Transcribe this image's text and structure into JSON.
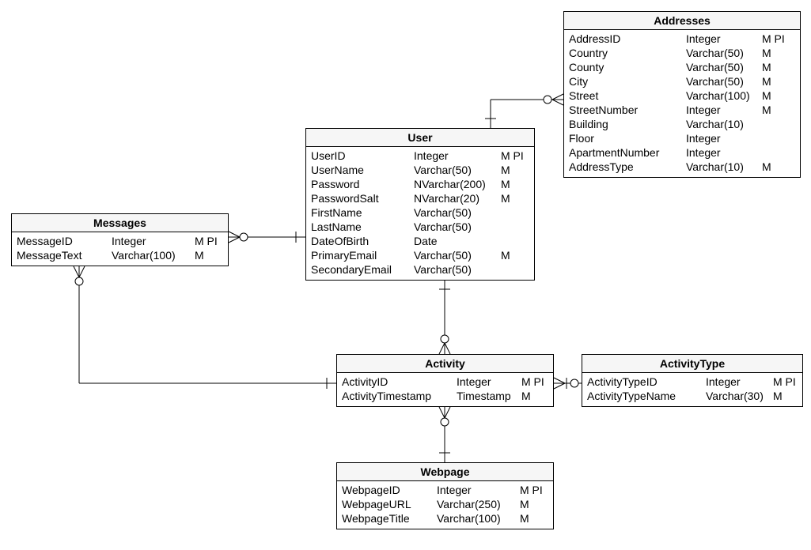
{
  "entities": {
    "addresses": {
      "title": "Addresses",
      "fields": [
        {
          "name": "AddressID",
          "type": "Integer",
          "flags": "M PI"
        },
        {
          "name": "Country",
          "type": "Varchar(50)",
          "flags": "M"
        },
        {
          "name": "County",
          "type": "Varchar(50)",
          "flags": "M"
        },
        {
          "name": "City",
          "type": "Varchar(50)",
          "flags": "M"
        },
        {
          "name": "Street",
          "type": "Varchar(100)",
          "flags": "M"
        },
        {
          "name": "StreetNumber",
          "type": "Integer",
          "flags": "M"
        },
        {
          "name": "Building",
          "type": "Varchar(10)",
          "flags": ""
        },
        {
          "name": "Floor",
          "type": "Integer",
          "flags": ""
        },
        {
          "name": "ApartmentNumber",
          "type": "Integer",
          "flags": ""
        },
        {
          "name": "AddressType",
          "type": "Varchar(10)",
          "flags": "M"
        }
      ]
    },
    "user": {
      "title": "User",
      "fields": [
        {
          "name": "UserID",
          "type": "Integer",
          "flags": "M PI"
        },
        {
          "name": "UserName",
          "type": "Varchar(50)",
          "flags": "M"
        },
        {
          "name": "Password",
          "type": "NVarchar(200)",
          "flags": "M"
        },
        {
          "name": "PasswordSalt",
          "type": "NVarchar(20)",
          "flags": "M"
        },
        {
          "name": "FirstName",
          "type": "Varchar(50)",
          "flags": ""
        },
        {
          "name": "LastName",
          "type": "Varchar(50)",
          "flags": ""
        },
        {
          "name": "DateOfBirth",
          "type": "Date",
          "flags": ""
        },
        {
          "name": "PrimaryEmail",
          "type": "Varchar(50)",
          "flags": "M"
        },
        {
          "name": "SecondaryEmail",
          "type": "Varchar(50)",
          "flags": ""
        }
      ]
    },
    "messages": {
      "title": "Messages",
      "fields": [
        {
          "name": "MessageID",
          "type": "Integer",
          "flags": "M PI"
        },
        {
          "name": "MessageText",
          "type": "Varchar(100)",
          "flags": "M"
        }
      ]
    },
    "activity": {
      "title": "Activity",
      "fields": [
        {
          "name": "ActivityID",
          "type": "Integer",
          "flags": "M PI"
        },
        {
          "name": "ActivityTimestamp",
          "type": "Timestamp",
          "flags": "M"
        }
      ]
    },
    "activitytype": {
      "title": "ActivityType",
      "fields": [
        {
          "name": "ActivityTypeID",
          "type": "Integer",
          "flags": "M PI"
        },
        {
          "name": "ActivityTypeName",
          "type": "Varchar(30)",
          "flags": "M"
        }
      ]
    },
    "webpage": {
      "title": "Webpage",
      "fields": [
        {
          "name": "WebpageID",
          "type": "Integer",
          "flags": "M PI"
        },
        {
          "name": "WebpageURL",
          "type": "Varchar(250)",
          "flags": "M"
        },
        {
          "name": "WebpageTitle",
          "type": "Varchar(100)",
          "flags": "M"
        }
      ]
    }
  },
  "relationships": [
    {
      "from": "User",
      "to": "Addresses",
      "from_card": "one-mandatory",
      "to_card": "many-optional"
    },
    {
      "from": "Messages",
      "to": "User",
      "from_card": "many-optional",
      "to_card": "one-mandatory"
    },
    {
      "from": "User",
      "to": "Activity",
      "from_card": "one-mandatory",
      "to_card": "many-optional"
    },
    {
      "from": "Messages",
      "to": "Activity",
      "from_card": "one-mandatory",
      "to_card": "many-optional"
    },
    {
      "from": "Activity",
      "to": "ActivityType",
      "from_card": "many-mandatory",
      "to_card": "one-optional"
    },
    {
      "from": "Activity",
      "to": "Webpage",
      "from_card": "many-optional",
      "to_card": "one-mandatory"
    }
  ]
}
